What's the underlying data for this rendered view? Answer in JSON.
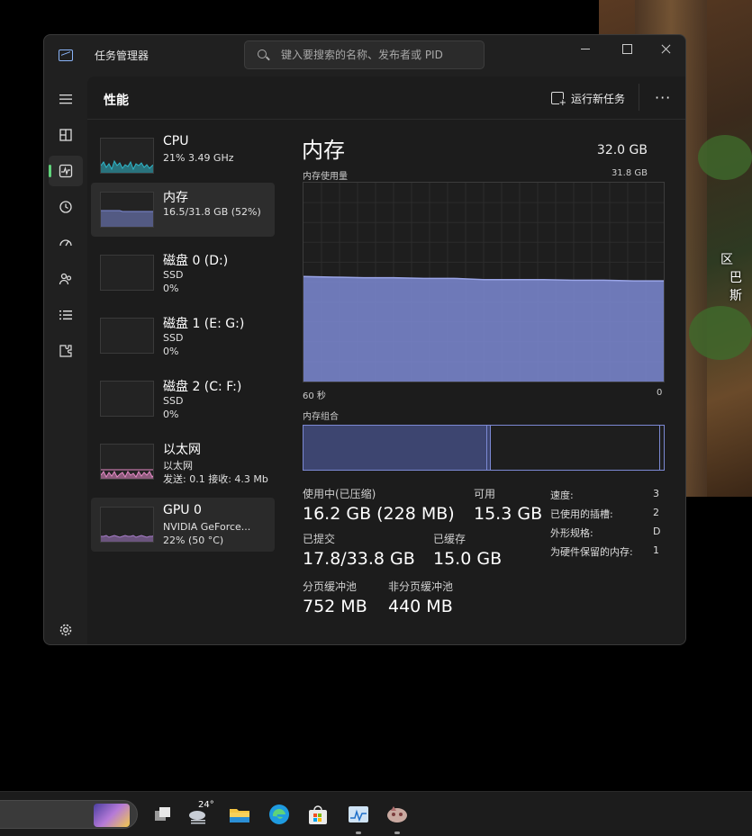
{
  "window": {
    "title": "任务管理器",
    "search_placeholder": "键入要搜索的名称、发布者或 PID"
  },
  "header": {
    "title": "性能",
    "run_new_task": "运行新任务",
    "more": "···"
  },
  "perf_items": [
    {
      "name": "CPU",
      "sub1": "21% 3.49 GHz",
      "sub2": "",
      "color": "#2fb6c9"
    },
    {
      "name": "内存",
      "sub1": "16.5/31.8 GB (52%)",
      "sub2": "",
      "color": "#7c89d4"
    },
    {
      "name": "磁盘 0 (D:)",
      "sub1": "SSD",
      "sub2": "0%",
      "color": "#3fb68a"
    },
    {
      "name": "磁盘 1 (E: G:)",
      "sub1": "SSD",
      "sub2": "0%",
      "color": "#3fb68a"
    },
    {
      "name": "磁盘 2 (C: F:)",
      "sub1": "SSD",
      "sub2": "0%",
      "color": "#3fb68a"
    },
    {
      "name": "以太网",
      "sub1": "以太网",
      "sub2": "发送: 0.1 接收: 4.3 Mb",
      "color": "#e58ac6"
    },
    {
      "name": "GPU 0",
      "sub1": "NVIDIA GeForce...",
      "sub2": "22% (50 °C)",
      "color": "#a87dc9"
    }
  ],
  "detail": {
    "title": "内存",
    "total": "32.0 GB",
    "usage_label": "内存使用量",
    "usage_max": "31.8 GB",
    "axis_left": "60 秒",
    "axis_right": "0",
    "composition_label": "内存组合",
    "stats": {
      "in_use_label": "使用中(已压缩)",
      "in_use_value": "16.2 GB (228 MB)",
      "available_label": "可用",
      "available_value": "15.3 GB",
      "committed_label": "已提交",
      "committed_value": "17.8/33.8 GB",
      "cached_label": "已缓存",
      "cached_value": "15.0 GB",
      "paged_label": "分页缓冲池",
      "paged_value": "752 MB",
      "nonpaged_label": "非分页缓冲池",
      "nonpaged_value": "440 MB"
    },
    "kv": [
      {
        "k": "速度:",
        "v": "3"
      },
      {
        "k": "已使用的插槽:",
        "v": "2"
      },
      {
        "k": "外形规格:",
        "v": "D"
      },
      {
        "k": "为硬件保留的内存:",
        "v": "1"
      }
    ]
  },
  "chart_data": {
    "type": "area",
    "x": [
      60,
      55,
      50,
      45,
      40,
      35,
      30,
      25,
      20,
      15,
      10,
      5,
      0
    ],
    "values": [
      16.8,
      16.7,
      16.6,
      16.6,
      16.5,
      16.5,
      16.3,
      16.3,
      16.3,
      16.2,
      16.2,
      16.1,
      16.1
    ],
    "ylim": [
      0,
      31.8
    ],
    "grid": true,
    "color": "#7c89d4"
  },
  "composition": [
    {
      "fraction": 0.51,
      "color": "#3d4570"
    },
    {
      "fraction": 0.01,
      "color": "#3d4570"
    },
    {
      "fraction": 0.47,
      "color": "#1e1e1e"
    },
    {
      "fraction": 0.01,
      "color": "#1e1e1e"
    }
  ],
  "game_text": [
    "区",
    "巴斯"
  ],
  "taskbar": {
    "weather_temp": "24°"
  }
}
